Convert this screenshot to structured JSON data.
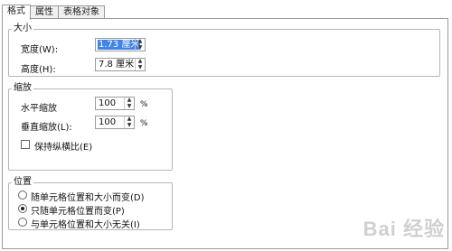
{
  "tabs": [
    {
      "label": "格式",
      "active": true
    },
    {
      "label": "属性",
      "active": false
    },
    {
      "label": "表格对象",
      "active": false
    }
  ],
  "size_group": {
    "title": "大小",
    "width_label": "宽度(W):",
    "width_value": "1.73 厘米",
    "height_label": "高度(H):",
    "height_value": "7.8 厘米"
  },
  "scale_group": {
    "title": "缩放",
    "horizontal_label": "水平缩放",
    "horizontal_value": "100",
    "vertical_label": "垂直缩放(L):",
    "vertical_value": "100",
    "percent_unit": "%",
    "lock_ratio_label": "保持纵横比(E)",
    "lock_ratio_checked": false
  },
  "position_group": {
    "title": "位置",
    "options": [
      {
        "label": "随单元格位置和大小而变(D)",
        "checked": false
      },
      {
        "label": "只随单元格位置而变(P)",
        "checked": true
      },
      {
        "label": "与单元格位置和大小无关(I)",
        "checked": false
      }
    ]
  },
  "arrow_up": "▲",
  "arrow_down": "▼",
  "watermark": "Bai 经验"
}
